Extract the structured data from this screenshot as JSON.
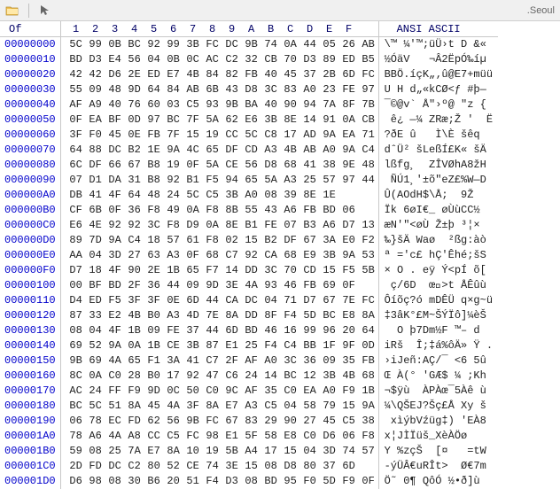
{
  "toolbar": {
    "title_suffix": ".Seoul"
  },
  "headers": {
    "offset_label": "Of",
    "hex_cols": [
      "1",
      "2",
      "3",
      "4",
      "5",
      "6",
      "7",
      "8",
      "9",
      "A",
      "B",
      "C",
      "D",
      "E",
      "F"
    ],
    "ascii_label": "ANSI ASCII"
  },
  "rows": [
    {
      "o": "00000000",
      "h": [
        "5C",
        "99",
        "0B",
        "BC",
        "92",
        "99",
        "3B",
        "FC",
        "DC",
        "9B",
        "74",
        "0A",
        "44",
        "05",
        "26",
        "AB"
      ],
      "a": "\\™ ¼'™;üÜ›t D &«"
    },
    {
      "o": "00000010",
      "h": [
        "BD",
        "D3",
        "E4",
        "56",
        "04",
        "0B",
        "0C",
        "AC",
        "C2",
        "32",
        "CB",
        "70",
        "D3",
        "89",
        "ED",
        "B5"
      ],
      "a": "½ÓäV   ¬Â2ËpÓ‰íµ"
    },
    {
      "o": "00000020",
      "h": [
        "42",
        "42",
        "D6",
        "2E",
        "ED",
        "E7",
        "4B",
        "84",
        "82",
        "FB",
        "40",
        "45",
        "37",
        "2B",
        "6D",
        "FC"
      ],
      "a": "BBÖ.íçK„‚û@E7+müü"
    },
    {
      "o": "00000030",
      "h": [
        "55",
        "09",
        "48",
        "9D",
        "64",
        "84",
        "AB",
        "6B",
        "43",
        "D8",
        "3C",
        "83",
        "A0",
        "23",
        "FE",
        "97"
      ],
      "a": "U H d„«kCØ<ƒ #þ—"
    },
    {
      "o": "00000040",
      "h": [
        "AF",
        "A9",
        "40",
        "76",
        "60",
        "03",
        "C5",
        "93",
        "9B",
        "BA",
        "40",
        "90",
        "94",
        "7A",
        "8F",
        "7B"
      ],
      "a": "¯©@v` Å\"›º@ \"z {"
    },
    {
      "o": "00000050",
      "h": [
        "0F",
        "EA",
        "BF",
        "0D",
        "97",
        "BC",
        "7F",
        "5A",
        "62",
        "E6",
        "3B",
        "8E",
        "14",
        "91",
        "0A",
        "CB"
      ],
      "a": " ê¿ —¼ ZRæ;Ž '  Ë"
    },
    {
      "o": "00000060",
      "h": [
        "3F",
        "F0",
        "45",
        "0E",
        "FB",
        "7F",
        "15",
        "19",
        "CC",
        "5C",
        "C8",
        "17",
        "AD",
        "9A",
        "EA",
        "71"
      ],
      "a": "?ðE û   Ì\\È ­šêq"
    },
    {
      "o": "00000070",
      "h": [
        "64",
        "88",
        "DC",
        "B2",
        "1E",
        "9A",
        "4C",
        "65",
        "DF",
        "CD",
        "A3",
        "4B",
        "AB",
        "A0",
        "9A",
        "C4"
      ],
      "a": "dˆÜ² šLeßÍ£K« šÄ"
    },
    {
      "o": "00000080",
      "h": [
        "6C",
        "DF",
        "66",
        "67",
        "B8",
        "19",
        "0F",
        "5A",
        "CE",
        "56",
        "D8",
        "68",
        "41",
        "38",
        "9E",
        "48"
      ],
      "a": "lßfg¸  ZÎVØhA8žH"
    },
    {
      "o": "00000090",
      "h": [
        "07",
        "D1",
        "DA",
        "31",
        "B8",
        "92",
        "B1",
        "F5",
        "94",
        "65",
        "5A",
        "A3",
        "25",
        "57",
        "97",
        "44"
      ],
      "a": " ÑÚ1¸'±õ\"eZ£%W—D"
    },
    {
      "o": "000000A0",
      "h": [
        "DB",
        "41",
        "4F",
        "64",
        "48",
        "24",
        "5C",
        "C5",
        "3B",
        "A0",
        "08",
        "39",
        "8E",
        "1E"
      ],
      "a": "Û(AOdH$\\Å;  9Ž "
    },
    {
      "o": "000000B0",
      "h": [
        "CF",
        "6B",
        "0F",
        "36",
        "F8",
        "49",
        "0A",
        "F8",
        "8B",
        "55",
        "43",
        "A6",
        "FB",
        "BD",
        "06"
      ],
      "a": "Ïk 6øI€_ øÙùCC½ "
    },
    {
      "o": "000000C0",
      "h": [
        "E6",
        "4E",
        "92",
        "92",
        "3C",
        "F8",
        "D9",
        "0A",
        "8E",
        "B1",
        "FE",
        "07",
        "B3",
        "A6",
        "D7",
        "13"
      ],
      "a": "æN'\"<øÙ Ž±þ ³¦× "
    },
    {
      "o": "000000D0",
      "h": [
        "89",
        "7D",
        "9A",
        "C4",
        "18",
        "57",
        "61",
        "F8",
        "02",
        "15",
        "B2",
        "DF",
        "67",
        "3A",
        "E0",
        "F2"
      ],
      "a": "‰}šÄ Waø  ²ßg:àò"
    },
    {
      "o": "000000E0",
      "h": [
        "AA",
        "04",
        "3D",
        "27",
        "63",
        "A3",
        "0F",
        "68",
        "C7",
        "92",
        "CA",
        "68",
        "E9",
        "3B",
        "9A",
        "53"
      ],
      "a": "ª ='c£ hÇ'Êhé;šS"
    },
    {
      "o": "000000F0",
      "h": [
        "D7",
        "18",
        "4F",
        "90",
        "2E",
        "1B",
        "65",
        "F7",
        "14",
        "DD",
        "3C",
        "70",
        "CD",
        "15",
        "F5",
        "5B"
      ],
      "a": "× O . eÿ Ý<pÍ õ["
    },
    {
      "o": "00000100",
      "h": [
        "00",
        "BF",
        "BD",
        "2F",
        "36",
        "44",
        "09",
        "9D",
        "3E",
        "4A",
        "93",
        "46",
        "FB",
        "69",
        "0F"
      ],
      "a": " ç/6D  œ᷎>t ÅÊûù"
    },
    {
      "o": "00000110",
      "h": [
        "D4",
        "ED",
        "F5",
        "3F",
        "3F",
        "0E",
        "6D",
        "44",
        "CA",
        "DC",
        "04",
        "71",
        "D7",
        "67",
        "7E",
        "FC"
      ],
      "a": "Ôíõç?ó mDÊÜ q×g~ü"
    },
    {
      "o": "00000120",
      "h": [
        "87",
        "33",
        "E2",
        "4B",
        "B0",
        "A3",
        "4D",
        "7E",
        "8A",
        "DD",
        "8F",
        "F4",
        "5D",
        "BC",
        "E8",
        "8A"
      ],
      "a": "‡3âK°£M~ŠÝÏô]¼èŠ"
    },
    {
      "o": "00000130",
      "h": [
        "08",
        "04",
        "4F",
        "1B",
        "09",
        "FE",
        "37",
        "44",
        "6D",
        "BD",
        "46",
        "16",
        "99",
        "96",
        "20",
        "64"
      ],
      "a": "  O þ7Dm½F ™– d"
    },
    {
      "o": "00000140",
      "h": [
        "69",
        "52",
        "9A",
        "0A",
        "1B",
        "CE",
        "3B",
        "87",
        "E1",
        "25",
        "F4",
        "C4",
        "BB",
        "1F",
        "9F",
        "0D"
      ],
      "a": "iRš  Î;‡á%ôÄ» Ÿ ."
    },
    {
      "o": "00000150",
      "h": [
        "9B",
        "69",
        "4A",
        "65",
        "F1",
        "3A",
        "41",
        "C7",
        "2F",
        "AF",
        "A0",
        "3C",
        "36",
        "09",
        "35",
        "FB"
      ],
      "a": "›iJeñ:AÇ/¯ <6 5û"
    },
    {
      "o": "00000160",
      "h": [
        "8C",
        "0A",
        "C0",
        "28",
        "B0",
        "17",
        "92",
        "47",
        "C6",
        "24",
        "14",
        "BC",
        "12",
        "3B",
        "4B",
        "68"
      ],
      "a": "Œ À(° 'GÆ$ ¼ ;Kh"
    },
    {
      "o": "00000170",
      "h": [
        "AC",
        "24",
        "FF",
        "F9",
        "9D",
        "0C",
        "50",
        "C0",
        "9C",
        "AF",
        "35",
        "C0",
        "EA",
        "A0",
        "F9",
        "1B"
      ],
      "a": "¬$ÿù  ÀPÀœ¯5Àê ù "
    },
    {
      "o": "00000180",
      "h": [
        "BC",
        "5C",
        "51",
        "8A",
        "45",
        "4A",
        "3F",
        "8A",
        "E7",
        "A3",
        "C5",
        "04",
        "58",
        "79",
        "15",
        "9A"
      ],
      "a": "¼\\QŠEJ?Šç£Å Xy š"
    },
    {
      "o": "00000190",
      "h": [
        "06",
        "78",
        "EC",
        "FD",
        "62",
        "56",
        "9B",
        "FC",
        "67",
        "83",
        "29",
        "90",
        "27",
        "45",
        "C5",
        "38"
      ],
      "a": " xìýbVźüg‡) 'EÀ8"
    },
    {
      "o": "000001A0",
      "h": [
        "78",
        "A6",
        "4A",
        "A8",
        "CC",
        "C5",
        "FC",
        "98",
        "E1",
        "5F",
        "58",
        "E8",
        "C0",
        "D6",
        "06",
        "F8"
      ],
      "a": "x¦JÌÏüš_XèÀÖø"
    },
    {
      "o": "000001B0",
      "h": [
        "59",
        "08",
        "25",
        "7A",
        "E7",
        "8A",
        "10",
        "19",
        "5B",
        "A4",
        "17",
        "15",
        "04",
        "3D",
        "74",
        "57"
      ],
      "a": "Y %zçŠ  [¤   =tW"
    },
    {
      "o": "000001C0",
      "h": [
        "2D",
        "FD",
        "DC",
        "C2",
        "80",
        "52",
        "CE",
        "74",
        "3E",
        "15",
        "08",
        "D8",
        "80",
        "37",
        "6D"
      ],
      "a": "-ýÜÂ€uRÎt>  Ø€7m"
    },
    {
      "o": "000001D0",
      "h": [
        "D6",
        "98",
        "08",
        "30",
        "B6",
        "20",
        "51",
        "F4",
        "D3",
        "08",
        "BD",
        "95",
        "F0",
        "5D",
        "F9",
        "0F"
      ],
      "a": "Ö˜ 0¶ QôÓ ½•ð]ù "
    }
  ]
}
